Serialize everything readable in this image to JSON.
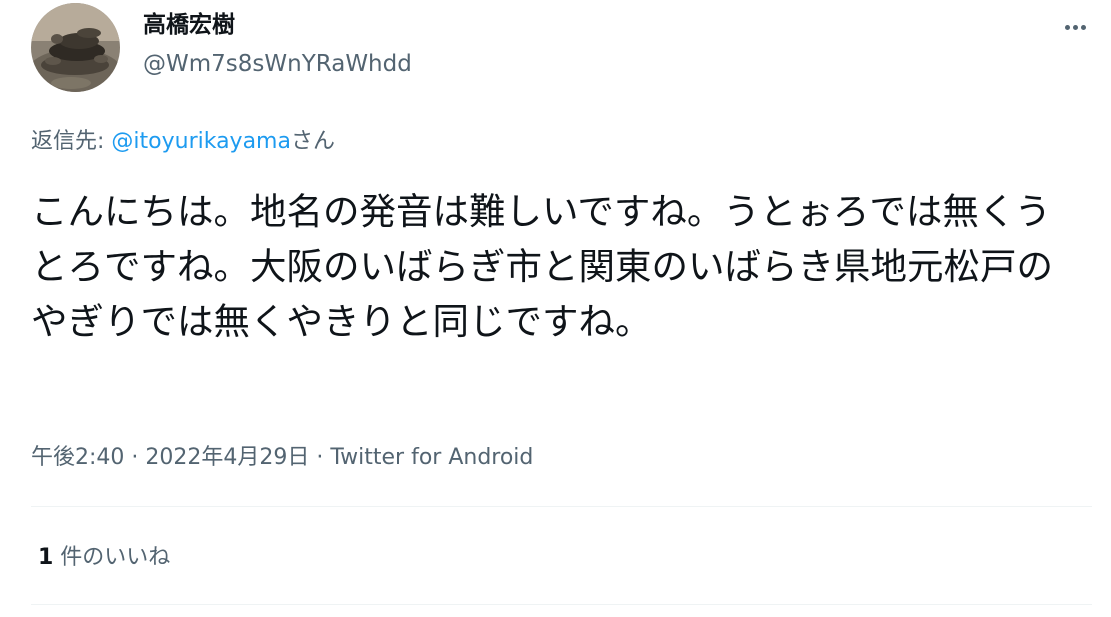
{
  "author": {
    "display_name": "高橋宏樹",
    "handle": "@Wm7s8sWnYRaWhdd",
    "avatar_icon": "turtle-photo-avatar"
  },
  "more_icon": "more-options-icon",
  "reply": {
    "prefix": "返信先: ",
    "mention": "@itoyurikayama",
    "suffix": "さん"
  },
  "tweet_text": "こんにちは。地名の発音は難しいですね。うとぉろでは無くうとろですね。大阪のいばらぎ市と関東のいばらき県地元松戸のやぎりでは無くやきりと同じですね。",
  "meta": {
    "time": "午後2:40",
    "separator1": " · ",
    "date": "2022年4月29日",
    "separator2": " · ",
    "source": "Twitter for Android"
  },
  "likes": {
    "count": "1",
    "label": " 件のいいね"
  },
  "colors": {
    "text": "#0f1419",
    "secondary": "#536471",
    "link": "#1d9bf0",
    "divider": "#eff3f4"
  }
}
